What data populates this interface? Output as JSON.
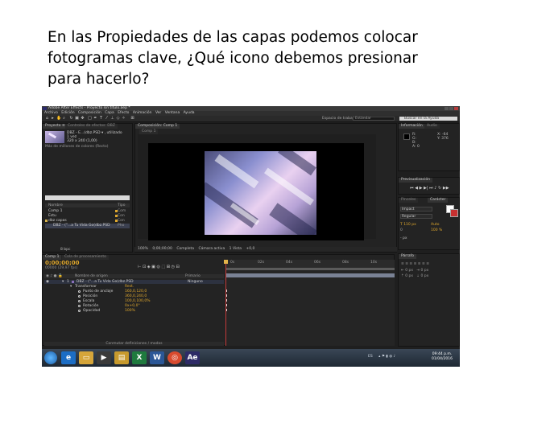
{
  "question": {
    "line1": "En las Propiedades de las capas podemos colocar",
    "line2": "fotogramas clave, ¿Qué icono debemos presionar",
    "line3": "para hacerlo?"
  },
  "app": {
    "title": "Adobe After Effects - Proyecto sin título.aep *",
    "menu": [
      "Archivo",
      "Edición",
      "Composición",
      "Capa",
      "Efecto",
      "Animación",
      "Ver",
      "Ventana",
      "Ayuda"
    ],
    "workspace_label": "Espacio de trabajo:",
    "workspace_value": "Estándar",
    "help_search": "Buscar en la Ayuda"
  },
  "project": {
    "tab": "Proyecto ≡",
    "tab2": "Controles de efectos: DBZ",
    "item_name": "DBZ - E...(dbz.PSD ▾ , utilizado 1 vez",
    "item_size": "320 x 240 (1,00)",
    "item_colors": "Más de millones de colores (Recto)",
    "col_name": "Nombre",
    "col_type": "Tipo",
    "rows": [
      {
        "name": "Comp 1",
        "type": "Com"
      },
      {
        "name": "Estu",
        "type": "Con"
      },
      {
        "name": "dbz capas",
        "type": "Con"
      },
      {
        "name": "DBZ - (\"...a Tu Vida Go(dbz.PSD",
        "type": "Pho"
      }
    ],
    "footer": "8 bpc"
  },
  "composition": {
    "tab": "Composición: Comp 1",
    "subtab": "Comp 1",
    "footer": [
      "100%",
      "0;00;00;00",
      "Completa",
      "Cámara activa",
      "1 Vista",
      "+0,0"
    ]
  },
  "info": {
    "tab": "Información",
    "tab2": "Audio",
    "rgb": [
      "R:",
      "G:",
      "B:",
      "A: 0"
    ],
    "coords": [
      "X: -64",
      "Y: 376"
    ]
  },
  "preview": {
    "tab": "Previsualización"
  },
  "paragraph": {
    "tab": "Párrafo"
  },
  "character": {
    "tab": "Pinceles",
    "tab2": "Carácter",
    "font": "Impact",
    "style": "Regular",
    "size": "110 px",
    "leading": "Auto",
    "tracking": "100 %",
    "kerning": "0",
    "px": "- px"
  },
  "timeline": {
    "tab": "Comp 1",
    "tab2": "Cola de procesamiento",
    "time": "0;00;00;00",
    "fps": "00000 (29,97 fps)",
    "col_layer": "Nombre de origen",
    "col_parent": "Primario",
    "layer": "DBZ - (\"...a Tu Vida Go(dbz.PSD",
    "layer_num": "1",
    "parent": "Ninguno",
    "transform": "Transformar",
    "reset": "Rest.",
    "props": [
      {
        "name": "Punto de anclaje",
        "value": "160,0,120,0"
      },
      {
        "name": "Posición",
        "value": "360,0,240,0"
      },
      {
        "name": "Escala",
        "value": "100,0,100,0%"
      },
      {
        "name": "Rotación",
        "value": "0x+0,0°"
      },
      {
        "name": "Opacidad",
        "value": "100%"
      }
    ],
    "ruler": [
      "0s",
      "02s",
      "04s",
      "06s",
      "08s",
      "10s"
    ],
    "toggle": "Conmutar definiciones / modos"
  },
  "taskbar": {
    "lang": "ES",
    "time": "09:44 p.m.",
    "date": "01/04/2016",
    "apps": [
      "ie",
      "explorer",
      "media",
      "folder",
      "excel",
      "word",
      "chrome",
      "ae"
    ]
  },
  "colors": {
    "ae_orange": "#e0a82d",
    "cti_red": "#c43a3a",
    "panel_bg": "#232323"
  }
}
